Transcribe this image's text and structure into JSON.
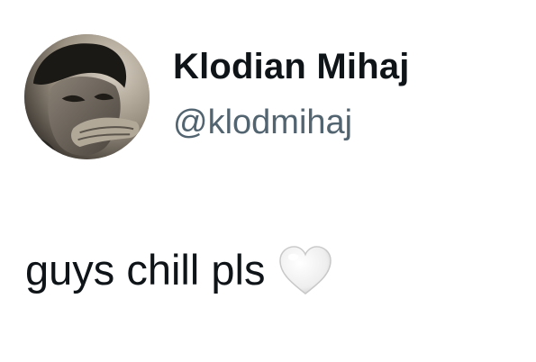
{
  "user": {
    "display_name": "Klodian Mihaj",
    "handle": "@klodmihaj",
    "avatar_icon": "profile-photo"
  },
  "tweet": {
    "text": "guys chill pls",
    "emoji_icon": "white-heart-icon"
  },
  "colors": {
    "name": "#0f1419",
    "handle": "#536471",
    "text": "#0f1419",
    "background": "#ffffff"
  }
}
